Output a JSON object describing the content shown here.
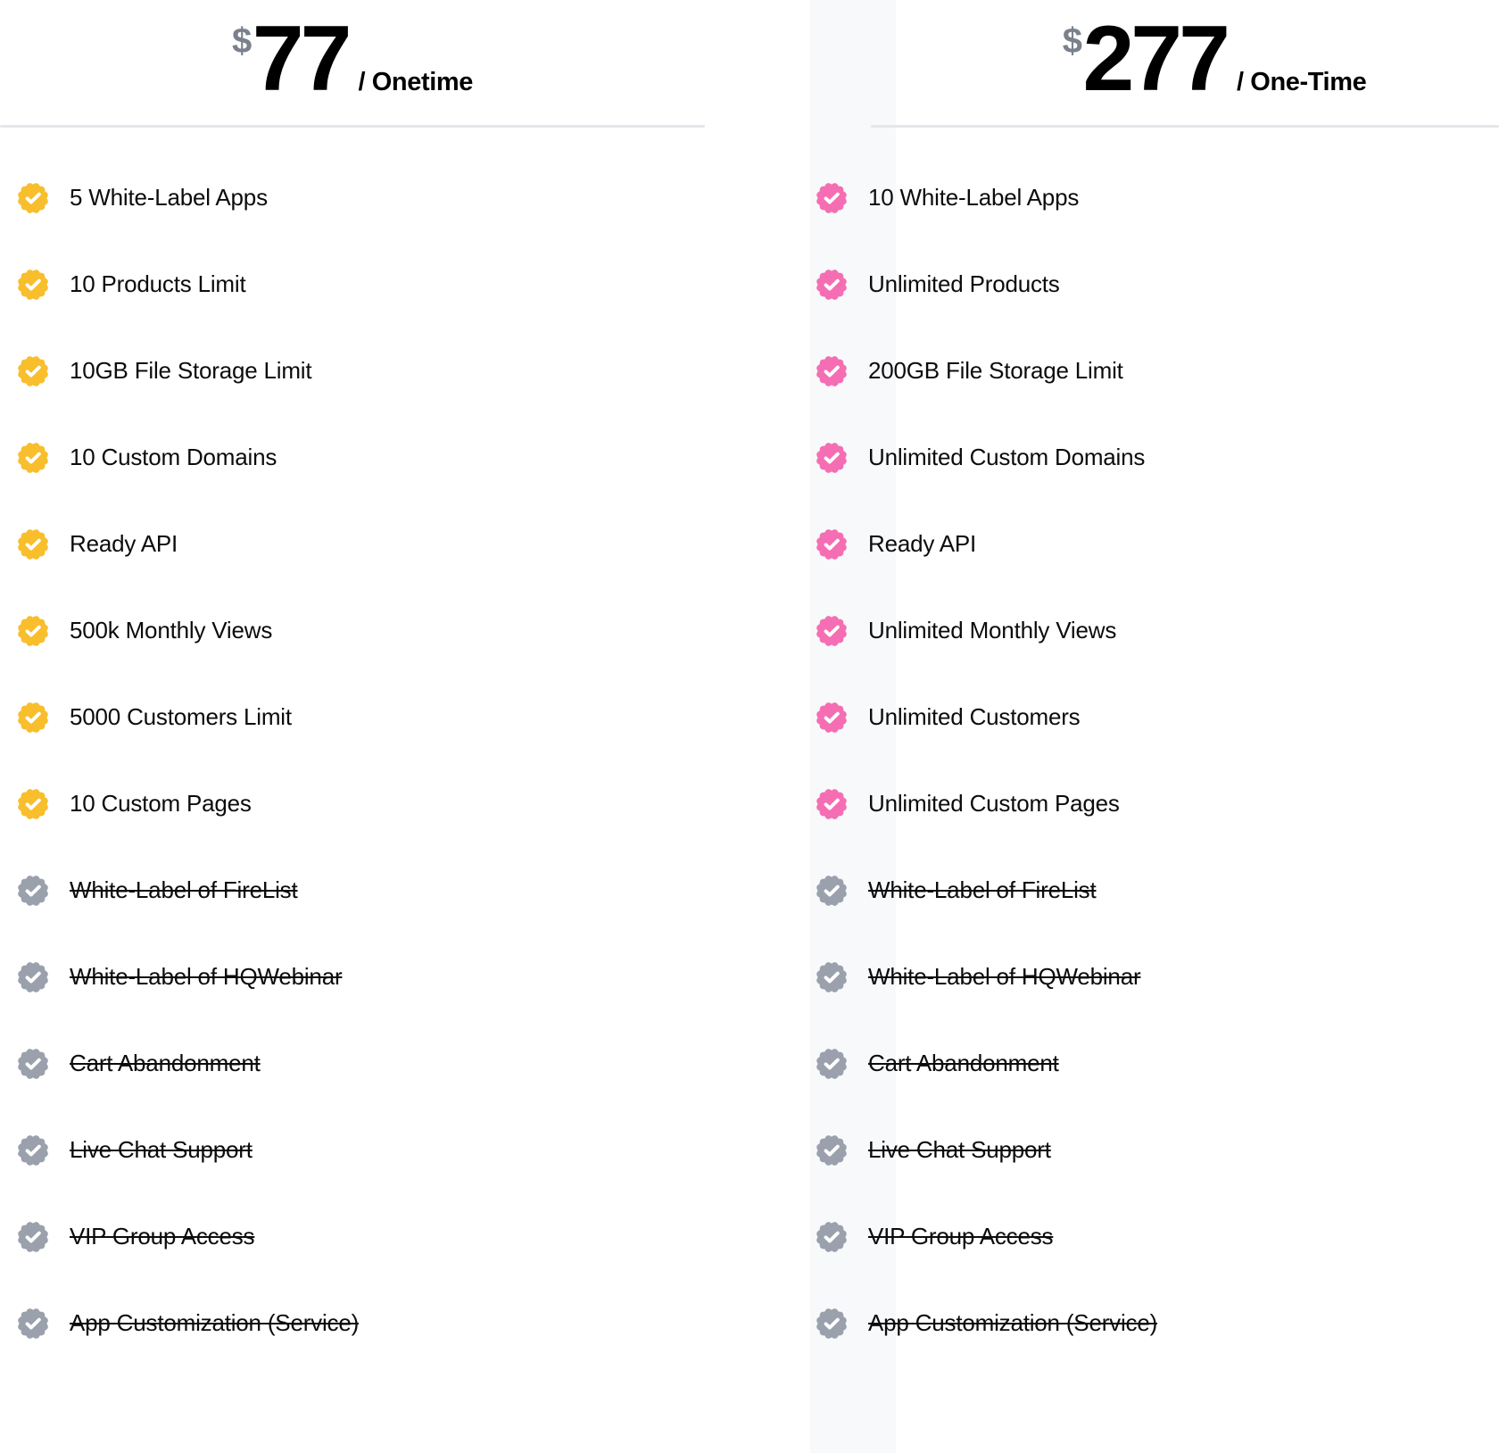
{
  "colors": {
    "plan_one_accent": "#F8BE2C",
    "plan_two_accent": "#F56EB3",
    "disabled_icon": "#9AA1AC",
    "divider": "#E3E6EA",
    "gutter": "#F8F9FB",
    "currency_text": "#7A818D",
    "label_text": "#0C0C0D"
  },
  "plans": [
    {
      "currency": "$",
      "amount": "77",
      "period": "/ Onetime",
      "features": [
        {
          "label": "5 White-Label Apps",
          "included": true
        },
        {
          "label": "10 Products Limit",
          "included": true
        },
        {
          "label": "10GB File Storage Limit",
          "included": true
        },
        {
          "label": "10 Custom Domains",
          "included": true
        },
        {
          "label": "Ready API",
          "included": true
        },
        {
          "label": "500k Monthly Views",
          "included": true
        },
        {
          "label": "5000 Customers Limit",
          "included": true
        },
        {
          "label": "10 Custom Pages",
          "included": true
        },
        {
          "label": "White-Label of FireList",
          "included": false
        },
        {
          "label": "White-Label of HQWebinar",
          "included": false
        },
        {
          "label": "Cart Abandonment",
          "included": false
        },
        {
          "label": "Live Chat Support",
          "included": false
        },
        {
          "label": "VIP Group Access",
          "included": false
        },
        {
          "label": "App Customization (Service)",
          "included": false
        }
      ]
    },
    {
      "currency": "$",
      "amount": "277",
      "period": "/ One-Time",
      "features": [
        {
          "label": "10 White-Label Apps",
          "included": true
        },
        {
          "label": "Unlimited Products",
          "included": true
        },
        {
          "label": "200GB File Storage Limit",
          "included": true
        },
        {
          "label": "Unlimited Custom Domains",
          "included": true
        },
        {
          "label": "Ready API",
          "included": true
        },
        {
          "label": "Unlimited Monthly Views",
          "included": true
        },
        {
          "label": "Unlimited Customers",
          "included": true
        },
        {
          "label": "Unlimited Custom Pages",
          "included": true
        },
        {
          "label": "White-Label of FireList",
          "included": false
        },
        {
          "label": "White-Label of HQWebinar",
          "included": false
        },
        {
          "label": "Cart Abandonment",
          "included": false
        },
        {
          "label": "Live Chat Support",
          "included": false
        },
        {
          "label": "VIP Group Access",
          "included": false
        },
        {
          "label": "App Customization (Service)",
          "included": false
        }
      ]
    }
  ]
}
